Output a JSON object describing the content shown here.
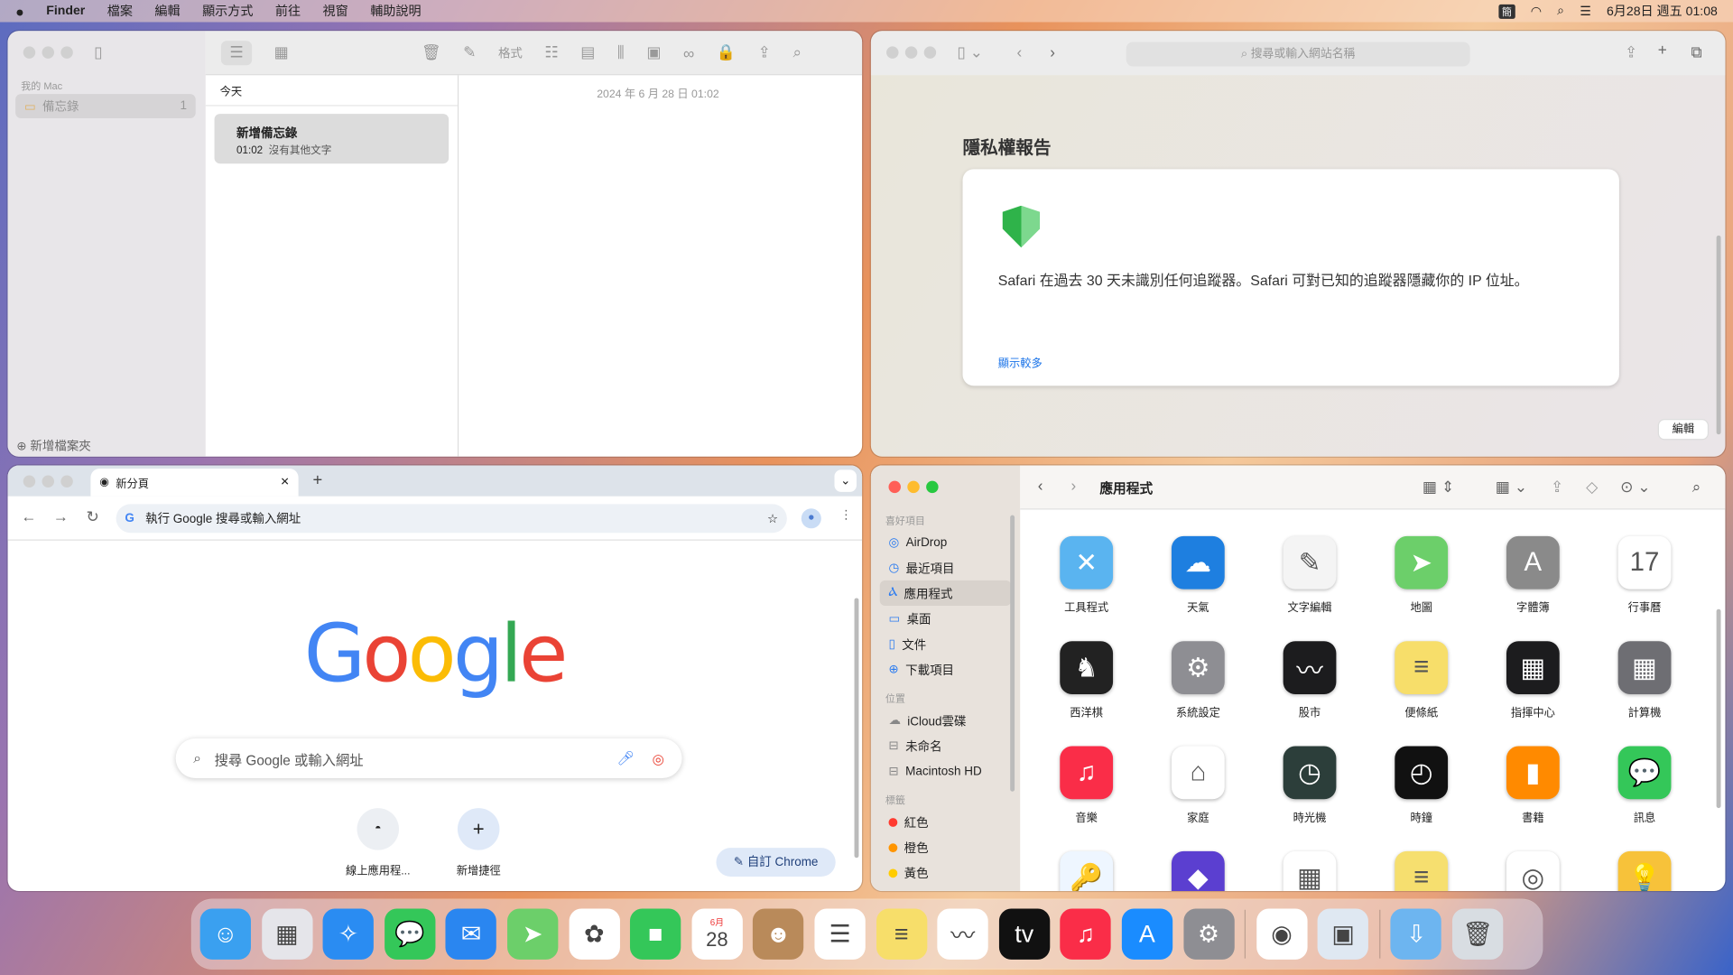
{
  "menubar": {
    "app": "Finder",
    "items": [
      "檔案",
      "編輯",
      "顯示方式",
      "前往",
      "視窗",
      "輔助說明"
    ],
    "input_method": "簡",
    "datetime": "6月28日 週五 01:08"
  },
  "notes": {
    "sidebar_section": "我的 Mac",
    "folder": "備忘錄",
    "folder_count": "1",
    "new_folder": "新增檔案夾",
    "format_label": "格式",
    "list_header": "今天",
    "note_title": "新增備忘錄",
    "note_time": "01:02",
    "note_preview": "沒有其他文字",
    "editor_date": "2024 年 6 月 28 日 01:02"
  },
  "safari": {
    "address_placeholder": "搜尋或輸入網站名稱",
    "privacy_title": "隱私權報告",
    "privacy_text": "Safari 在過去 30 天未識別任何追蹤器。Safari 可對已知的追蹤器隱藏你的 IP 位址。",
    "show_more": "顯示較多",
    "edit": "編輯",
    "accent": "#1a73e8"
  },
  "chrome": {
    "tab_title": "新分頁",
    "omnibox": "執行 Google 搜尋或輸入網址",
    "search_placeholder": "搜尋 Google 或輸入網址",
    "shortcuts": [
      "線上應用程...",
      "新增捷徑"
    ],
    "customize": "自訂 Chrome",
    "logo": "Google"
  },
  "finder": {
    "title": "應用程式",
    "favorites_header": "喜好項目",
    "favorites": [
      "AirDrop",
      "最近項目",
      "應用程式",
      "桌面",
      "文件",
      "下載項目"
    ],
    "locations_header": "位置",
    "locations": [
      "iCloud雲碟",
      "未命名",
      "Macintosh HD"
    ],
    "tags_header": "標籤",
    "tags": [
      {
        "name": "紅色",
        "color": "#ff3b30"
      },
      {
        "name": "橙色",
        "color": "#ff9500"
      },
      {
        "name": "黃色",
        "color": "#ffcc00"
      }
    ],
    "apps": [
      {
        "name": "工具程式",
        "color": "#5ab4f0",
        "glyph": "✕"
      },
      {
        "name": "天氣",
        "color": "#1e7fe0",
        "glyph": "☁"
      },
      {
        "name": "文字編輯",
        "color": "#f4f4f4",
        "glyph": "✎"
      },
      {
        "name": "地圖",
        "color": "#6ccf6a",
        "glyph": "➤"
      },
      {
        "name": "字體簿",
        "color": "#8a8a8a",
        "glyph": "A"
      },
      {
        "name": "行事曆",
        "color": "#ffffff",
        "glyph": "17"
      },
      {
        "name": "西洋棋",
        "color": "#222222",
        "glyph": "♞"
      },
      {
        "name": "系統設定",
        "color": "#8e8e93",
        "glyph": "⚙"
      },
      {
        "name": "股市",
        "color": "#1c1c1e",
        "glyph": "〰"
      },
      {
        "name": "便條紙",
        "color": "#f7de6a",
        "glyph": "≡"
      },
      {
        "name": "指揮中心",
        "color": "#1c1c1e",
        "glyph": "▦"
      },
      {
        "name": "計算機",
        "color": "#6e6e73",
        "glyph": "▦"
      },
      {
        "name": "音樂",
        "color": "#fa2d48",
        "glyph": "♫"
      },
      {
        "name": "家庭",
        "color": "#ffffff",
        "glyph": "⌂"
      },
      {
        "name": "時光機",
        "color": "#2c3e3a",
        "glyph": "◷"
      },
      {
        "name": "時鐘",
        "color": "#111111",
        "glyph": "◴"
      },
      {
        "name": "書籍",
        "color": "#ff8a00",
        "glyph": "▮"
      },
      {
        "name": "訊息",
        "color": "#34c759",
        "glyph": "💬"
      },
      {
        "name": "",
        "color": "#eef6ff",
        "glyph": "🔑"
      },
      {
        "name": "",
        "color": "#5b3fd0",
        "glyph": "◆"
      },
      {
        "name": "",
        "color": "#ffffff",
        "glyph": "▦"
      },
      {
        "name": "",
        "color": "#f6df6f",
        "glyph": "≡"
      },
      {
        "name": "",
        "color": "#ffffff",
        "glyph": "◎"
      },
      {
        "name": "",
        "color": "#f7c23a",
        "glyph": "💡"
      }
    ]
  },
  "dock": [
    {
      "name": "finder",
      "color": "#3aa0f0",
      "glyph": "☺"
    },
    {
      "name": "launchpad",
      "color": "#e5e5ea",
      "glyph": "▦"
    },
    {
      "name": "safari",
      "color": "#2a8cf2",
      "glyph": "✧"
    },
    {
      "name": "messages",
      "color": "#34c759",
      "glyph": "💬"
    },
    {
      "name": "mail",
      "color": "#2a86f0",
      "glyph": "✉"
    },
    {
      "name": "maps",
      "color": "#6ccf6a",
      "glyph": "➤"
    },
    {
      "name": "photos",
      "color": "#ffffff",
      "glyph": "✿"
    },
    {
      "name": "facetime",
      "color": "#34c759",
      "glyph": "■"
    },
    {
      "name": "calendar",
      "color": "#ffffff",
      "glyph": "28",
      "label": "6月"
    },
    {
      "name": "contacts",
      "color": "#b98a5a",
      "glyph": "☻"
    },
    {
      "name": "reminders",
      "color": "#ffffff",
      "glyph": "☰"
    },
    {
      "name": "notes",
      "color": "#f7de6a",
      "glyph": "≡"
    },
    {
      "name": "freeform",
      "color": "#ffffff",
      "glyph": "〰"
    },
    {
      "name": "tv",
      "color": "#111111",
      "glyph": "tv"
    },
    {
      "name": "music",
      "color": "#fa2d48",
      "glyph": "♫"
    },
    {
      "name": "app-store",
      "color": "#1a8cff",
      "glyph": "A"
    },
    {
      "name": "system-settings",
      "color": "#8e8e93",
      "glyph": "⚙"
    },
    {
      "name": "chrome",
      "color": "#ffffff",
      "glyph": "◉"
    },
    {
      "name": "preview",
      "color": "#dfe8f2",
      "glyph": "▣"
    },
    {
      "name": "downloads",
      "color": "#6db5f0",
      "glyph": "⇩"
    },
    {
      "name": "trash",
      "color": "#d8dde2",
      "glyph": "🗑"
    }
  ]
}
